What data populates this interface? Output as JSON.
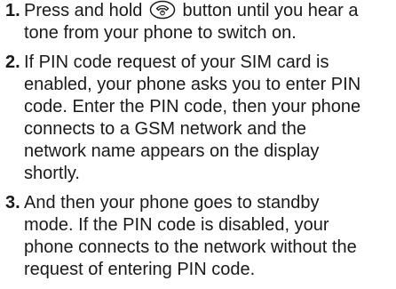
{
  "steps": [
    {
      "number": "1.",
      "line1_before_icon": "Press and hold ",
      "icon": "power-end-key-icon",
      "line1_after_icon": " button until you hear a",
      "lines": [
        "tone from your phone to switch on."
      ]
    },
    {
      "number": "2.",
      "lines": [
        "If PIN code request of your SIM card is",
        "enabled, your phone asks you to enter PIN",
        "code. Enter the PIN code, then your phone",
        "connects to a GSM network and the",
        "network name appears on the display",
        "shortly."
      ]
    },
    {
      "number": "3.",
      "lines": [
        "And then your phone goes to standby",
        "mode. If the PIN code is disabled, your",
        "phone connects to the network without the",
        "request of entering PIN code."
      ]
    }
  ]
}
